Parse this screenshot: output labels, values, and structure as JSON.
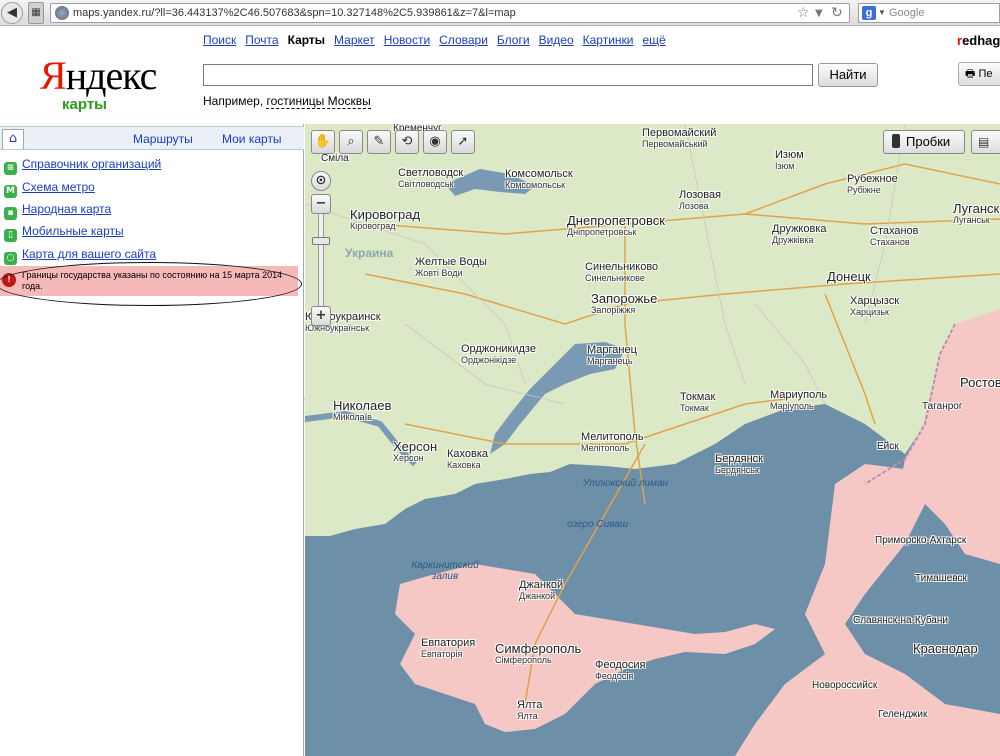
{
  "browser": {
    "url": "maps.yandex.ru/?ll=36.443137%2C46.507683&spn=10.327148%2C5.939861&z=7&l=map",
    "search_engine": "Google",
    "search_placeholder": "Google"
  },
  "header": {
    "logo_red": "Я",
    "logo_rest": "ндекс",
    "logo_sub": "карты",
    "services": [
      "Поиск",
      "Почта",
      "Карты",
      "Маркет",
      "Новости",
      "Словари",
      "Блоги",
      "Видео",
      "Картинки",
      "ещё"
    ],
    "active_service": "Карты",
    "search_button": "Найти",
    "example_prefix": "Например, ",
    "example_link": "гостиницы Москвы",
    "user_first": "r",
    "user_rest": "edhag",
    "print_label": "Пе"
  },
  "sidebar": {
    "home_tab": "⌂",
    "tab_routes": "Маршруты",
    "tab_mymaps": "Мои карты",
    "items": [
      {
        "label": "Справочник организаций",
        "icon": "directory-icon"
      },
      {
        "label": "Схема метро",
        "icon": "metro-icon"
      },
      {
        "label": "Народная карта",
        "icon": "people-map-icon"
      },
      {
        "label": "Мобильные карты",
        "icon": "mobile-icon"
      },
      {
        "label": "Карта для вашего сайта",
        "icon": "site-map-icon"
      }
    ],
    "notice": "Границы государства указаны по состоянию на 15 марта 2014 года.",
    "notice_icon": "!",
    "collapse_icon": "◀"
  },
  "map": {
    "tools": [
      "hand-icon",
      "magnifier-icon",
      "ruler-icon",
      "route-icon",
      "camera-icon",
      "pointer-icon"
    ],
    "traffic_button": "Пробки",
    "layers_icon": "layers-icon",
    "country": "Украина",
    "water": [
      "Утлюкский лиман",
      "озеро Сиваш",
      "Каркинитский залив"
    ],
    "cities": [
      {
        "name": "Кременчуг",
        "local": ""
      },
      {
        "name": "Сміла",
        "local": ""
      },
      {
        "name": "Светловодск",
        "local": "Світловодськ"
      },
      {
        "name": "Комсомольск",
        "local": "Комсомольськ"
      },
      {
        "name": "Первомайский",
        "local": "Первомайський"
      },
      {
        "name": "Изюм",
        "local": "Ізюм"
      },
      {
        "name": "Рубежное",
        "local": "Рубіжне"
      },
      {
        "name": "Луганск",
        "local": "Луганськ"
      },
      {
        "name": "Кировоград",
        "local": "Кіровоград"
      },
      {
        "name": "Днепропетровск",
        "local": "Дніпропетровськ"
      },
      {
        "name": "Лозовая",
        "local": "Лозова"
      },
      {
        "name": "Дружковка",
        "local": "Дружківка"
      },
      {
        "name": "Стаханов",
        "local": "Стаханов"
      },
      {
        "name": "Желтые Воды",
        "local": "Жовті Води"
      },
      {
        "name": "Синельниково",
        "local": "Синельникове"
      },
      {
        "name": "Донецк",
        "local": ""
      },
      {
        "name": "Запорожье",
        "local": "Запоріжжя"
      },
      {
        "name": "Харцызск",
        "local": "Харцизьк"
      },
      {
        "name": "Южноукраинск",
        "local": "Южноукраїнськ"
      },
      {
        "name": "Орджоникидзе",
        "local": "Орджонікідзе"
      },
      {
        "name": "Марганец",
        "local": "Марганець"
      },
      {
        "name": "Николаев",
        "local": "Миколаїв"
      },
      {
        "name": "Токмак",
        "local": "Токмак"
      },
      {
        "name": "Мариуполь",
        "local": "Маріуполь"
      },
      {
        "name": "Ростов",
        "local": ""
      },
      {
        "name": "Таганрог",
        "local": ""
      },
      {
        "name": "Херсон",
        "local": "Херсон"
      },
      {
        "name": "Каховка",
        "local": "Каховка"
      },
      {
        "name": "Мелитополь",
        "local": "Мелітополь"
      },
      {
        "name": "Ейск",
        "local": ""
      },
      {
        "name": "Бердянск",
        "local": "Бердянськ"
      },
      {
        "name": "Джанкой",
        "local": "Джанкой"
      },
      {
        "name": "Приморско-Ахтарск",
        "local": ""
      },
      {
        "name": "Тимашевск",
        "local": ""
      },
      {
        "name": "Славянск-на-Кубани",
        "local": ""
      },
      {
        "name": "Евпатория",
        "local": "Евпаторія"
      },
      {
        "name": "Симферополь",
        "local": "Сімферополь"
      },
      {
        "name": "Феодосия",
        "local": "Феодосія"
      },
      {
        "name": "Краснодар",
        "local": ""
      },
      {
        "name": "Новороссийск",
        "local": ""
      },
      {
        "name": "Ялта",
        "local": "Ялта"
      },
      {
        "name": "Геленджик",
        "local": ""
      }
    ]
  },
  "colors": {
    "ukraine": "#dce9c6",
    "russia": "#f5c8c6",
    "sea": "#6e8fa8",
    "link": "#1a3dc1",
    "notice_bg": "#f5b9b8"
  }
}
